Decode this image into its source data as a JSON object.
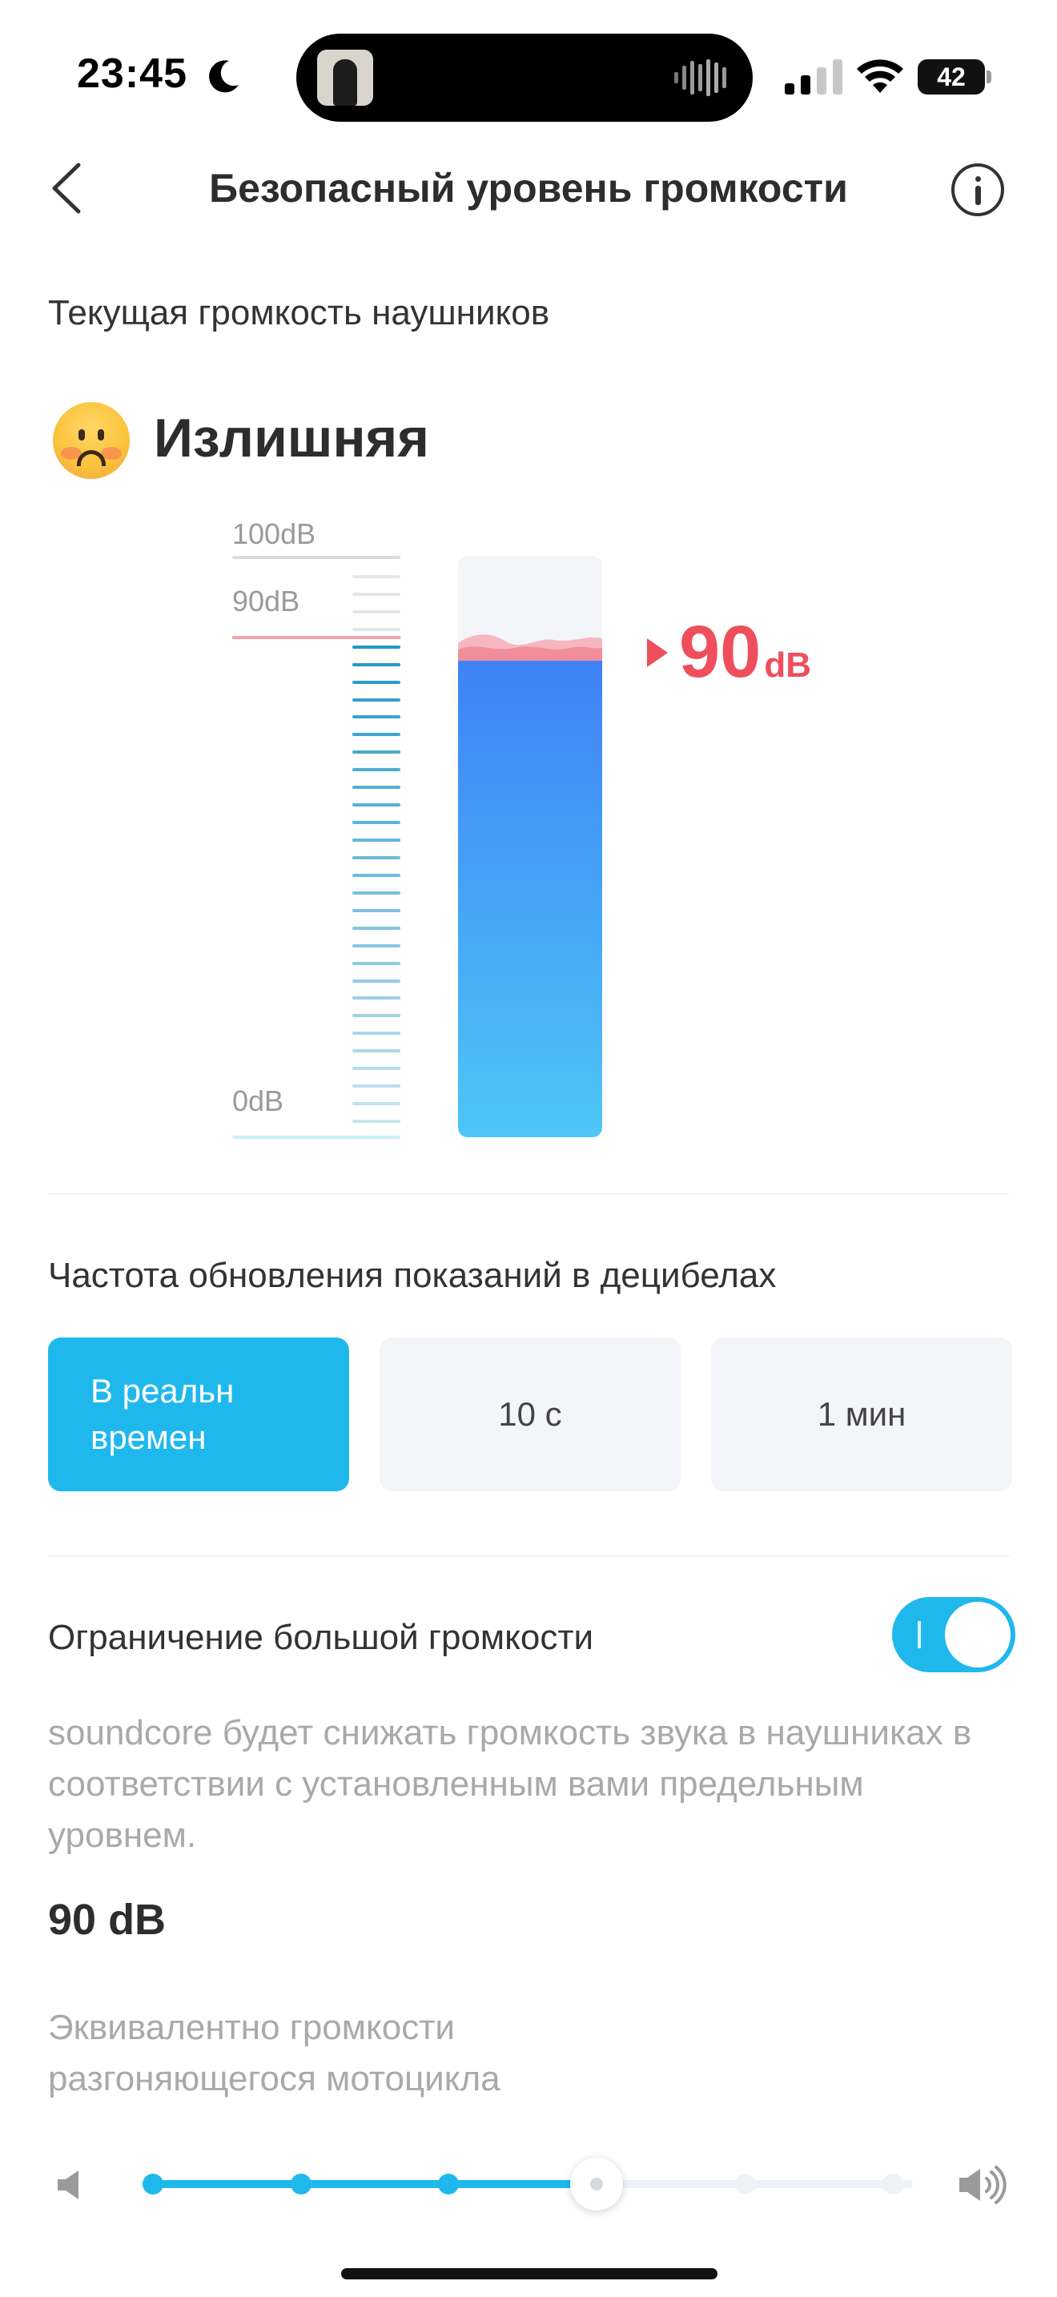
{
  "status_bar": {
    "time": "23:45",
    "battery": "42",
    "icons": [
      "moon-icon",
      "signal-icon",
      "wifi-icon",
      "battery-icon"
    ]
  },
  "header": {
    "title": "Безопасный уровень громкости",
    "back_icon": "chevron-left-icon",
    "info_icon": "info-icon"
  },
  "current_volume": {
    "label": "Текущая громкость наушников",
    "status": "Излишняя",
    "status_icon": "sad-face-emoji",
    "scale_labels": [
      "100dB",
      "90dB",
      "0dB"
    ],
    "level": 90,
    "level_max": 100,
    "readout_value": "90",
    "readout_unit": "dB",
    "colors": {
      "fill_top": "#3e82f5",
      "fill_bottom": "#4dc6f7",
      "warning": "#ef4f5d"
    }
  },
  "refresh_rate": {
    "label": "Частота обновления показаний в децибелах",
    "options": [
      "В реальн времен",
      "10 с",
      "1 мин"
    ],
    "selected": "В реальн времен"
  },
  "limit": {
    "label": "Ограничение большой громкости",
    "enabled": true,
    "description": "soundcore будет снижать громкость звука в наушниках в соответствии с установленным вами предельным уровнем.",
    "value": "90 dB",
    "equivalent": "Эквивалентно громкости разгоняющегося мотоцикла",
    "slider_steps": 6,
    "slider_index": 3,
    "accent": "#1fb8ec"
  }
}
